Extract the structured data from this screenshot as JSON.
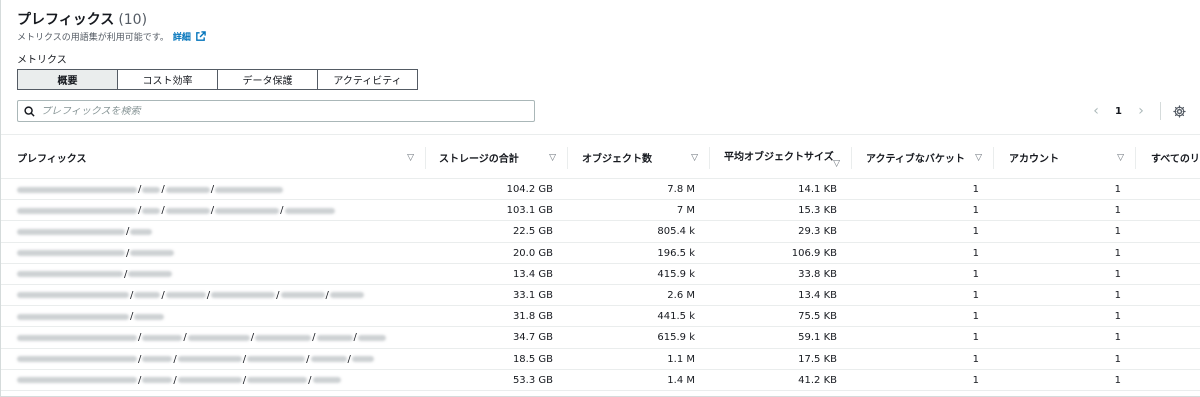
{
  "header": {
    "title": "プレフィックス",
    "count": "(10)",
    "description": "メトリクスの用語集が利用可能です。",
    "link_label": "詳細"
  },
  "metrics": {
    "label": "メトリクス",
    "tabs": [
      {
        "label": "概要",
        "active": true
      },
      {
        "label": "コスト効率",
        "active": false
      },
      {
        "label": "データ保護",
        "active": false
      },
      {
        "label": "アクティビティ",
        "active": false
      }
    ]
  },
  "search": {
    "placeholder": "プレフィックスを検索"
  },
  "pagination": {
    "current_page": "1"
  },
  "table": {
    "columns": [
      {
        "label": "プレフィックス"
      },
      {
        "label": "ストレージの合計"
      },
      {
        "label": "オブジェクト数"
      },
      {
        "label": "平均オブジェクトサイズ"
      },
      {
        "label": "アクティブなバケット"
      },
      {
        "label": "アカウント"
      },
      {
        "label": "すべてのリ"
      }
    ],
    "rows": [
      {
        "storage": "104.2 GB",
        "objects": "7.8 M",
        "avg_size": "14.1 KB",
        "buckets": "1",
        "accounts": "1"
      },
      {
        "storage": "103.1 GB",
        "objects": "7 M",
        "avg_size": "15.3 KB",
        "buckets": "1",
        "accounts": "1"
      },
      {
        "storage": "22.5 GB",
        "objects": "805.4 k",
        "avg_size": "29.3 KB",
        "buckets": "1",
        "accounts": "1"
      },
      {
        "storage": "20.0 GB",
        "objects": "196.5 k",
        "avg_size": "106.9 KB",
        "buckets": "1",
        "accounts": "1"
      },
      {
        "storage": "13.4 GB",
        "objects": "415.9 k",
        "avg_size": "33.8 KB",
        "buckets": "1",
        "accounts": "1"
      },
      {
        "storage": "33.1 GB",
        "objects": "2.6 M",
        "avg_size": "13.4 KB",
        "buckets": "1",
        "accounts": "1"
      },
      {
        "storage": "31.8 GB",
        "objects": "441.5 k",
        "avg_size": "75.5 KB",
        "buckets": "1",
        "accounts": "1"
      },
      {
        "storage": "34.7 GB",
        "objects": "615.9 k",
        "avg_size": "59.1 KB",
        "buckets": "1",
        "accounts": "1"
      },
      {
        "storage": "18.5 GB",
        "objects": "1.1 M",
        "avg_size": "17.5 KB",
        "buckets": "1",
        "accounts": "1"
      },
      {
        "storage": "53.3 GB",
        "objects": "1.4 M",
        "avg_size": "41.2 KB",
        "buckets": "1",
        "accounts": "1"
      }
    ]
  },
  "colors": {
    "link": "#0073bb",
    "border": "#aab7b8",
    "active_tab_bg": "#eaeded"
  }
}
